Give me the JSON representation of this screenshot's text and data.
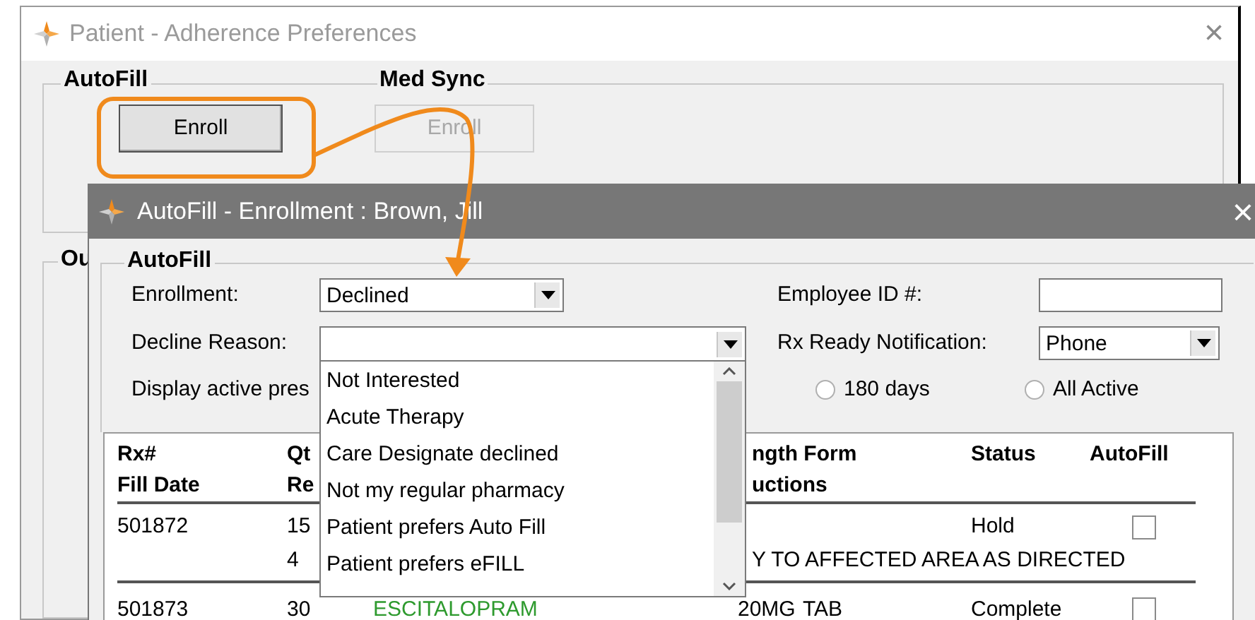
{
  "back_window": {
    "title": "Patient - Adherence Preferences",
    "close": "×",
    "autofill_group": {
      "legend": "AutoFill",
      "button": {
        "label": "Enroll",
        "disabled": false
      }
    },
    "med_sync_group": {
      "legend": "Med Sync",
      "button": {
        "label": "Enroll",
        "disabled": true
      }
    },
    "lower_group": {
      "legend": "Ou"
    }
  },
  "enrollment_window": {
    "title": "AutoFill - Enrollment : Brown, Jill",
    "close": "×",
    "group_legend": "AutoFill",
    "enrollment": {
      "label": "Enrollment:",
      "value": "Declined"
    },
    "employee_id": {
      "label": "Employee ID #:"
    },
    "decline_reason": {
      "label": "Decline Reason:",
      "expanded": true,
      "options": [
        {
          "label": "Not Interested",
          "selected": false
        },
        {
          "label": "Acute Therapy",
          "selected": false
        },
        {
          "label": "Care Designate declined",
          "selected": false
        },
        {
          "label": "Not my regular pharmacy",
          "selected": false
        },
        {
          "label": "Patient prefers Auto Fill",
          "selected": false
        },
        {
          "label": "Patient prefers eFILL",
          "selected": false
        }
      ]
    },
    "rx_ready": {
      "label": "Rx Ready Notification:",
      "value": "Phone"
    },
    "display_label": "Display active pres",
    "radios": [
      {
        "label": "180 days",
        "selected": false
      },
      {
        "label": "All Active",
        "selected": false
      }
    ],
    "table": {
      "headers": {
        "rx": [
          "Rx#",
          "Fill Date"
        ],
        "qty": [
          "Qt",
          "Re"
        ],
        "strength": [
          "ngth Form",
          "uctions"
        ],
        "status": "Status",
        "autofill": "AutoFill"
      },
      "rows": [
        {
          "rx": "501872",
          "qty": "15",
          "refills": "4",
          "status": "Hold",
          "autofill": false,
          "instructions": "Y TO AFFECTED AREA AS DIRECTED"
        },
        {
          "rx": "501873",
          "qty": "30",
          "drug": "ESCITALOPRAM",
          "strength": "20MG",
          "form": "TAB",
          "status": "Complete",
          "autofill": false
        }
      ]
    }
  }
}
